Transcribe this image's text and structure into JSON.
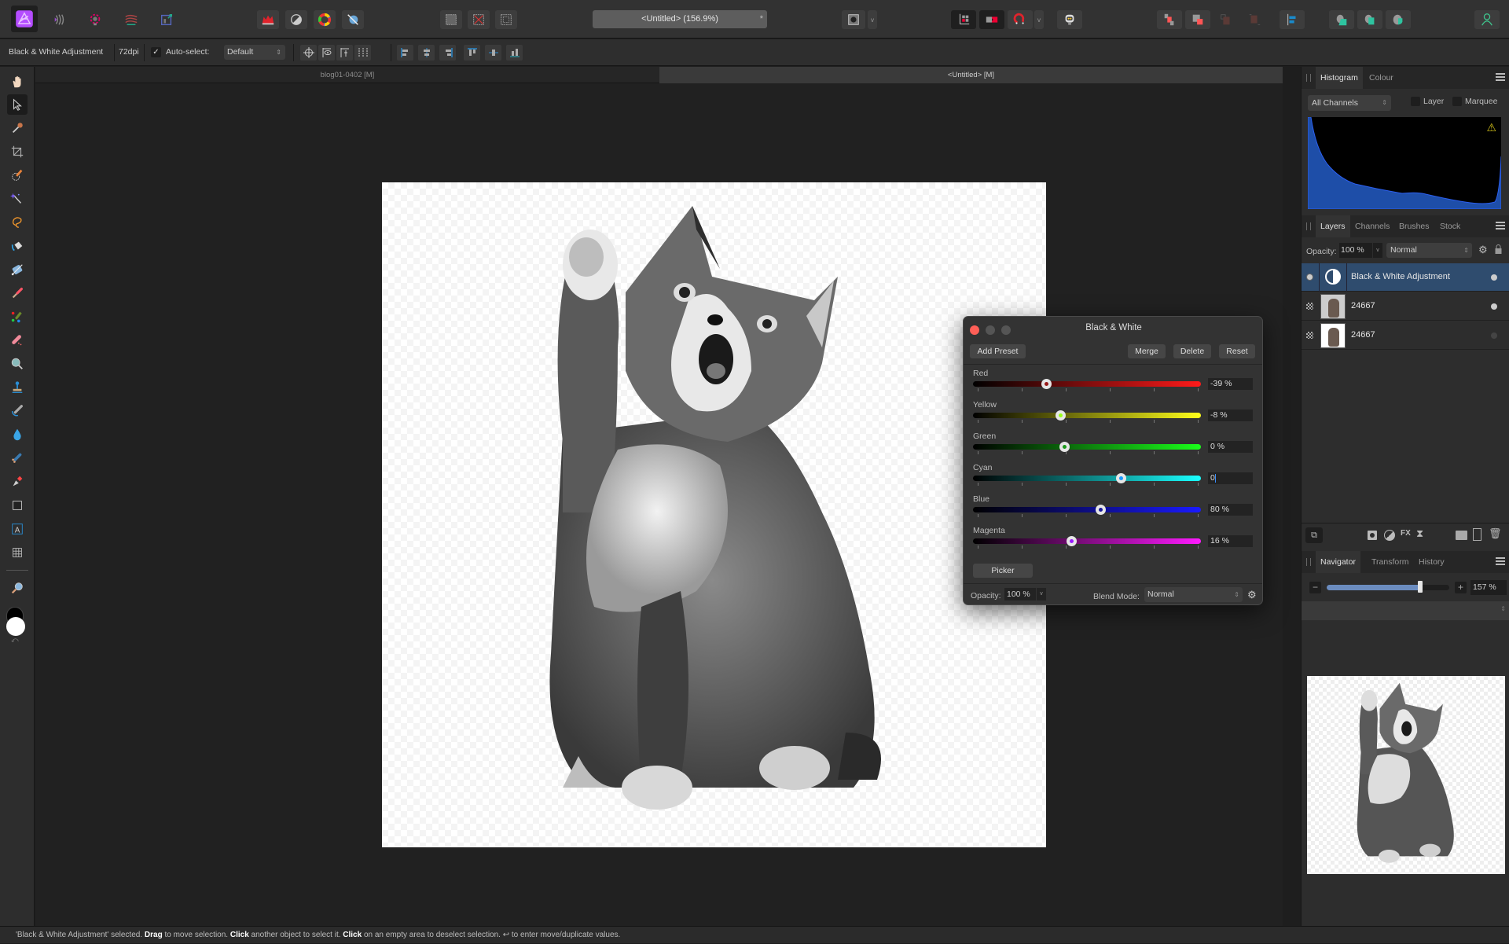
{
  "app": {
    "name": "Affinity Photo",
    "accent": "#a64cff"
  },
  "toolbar": {
    "personas": [
      "photo-persona",
      "liquify-persona",
      "develop-persona",
      "tone-mapping-persona",
      "export-persona"
    ],
    "document_title": "<Untitled> (156.9%)",
    "modified_marker": "*",
    "snapping_dropdown": "v"
  },
  "context_bar": {
    "selection_label": "Black & White Adjustment",
    "dpi": "72dpi",
    "auto_select_label": "Auto-select:",
    "auto_select_checked": true,
    "auto_select_value": "Default"
  },
  "doc_tabs": [
    {
      "label": "blog01-0402 [M]",
      "active": false
    },
    {
      "label": "<Untitled> [M]",
      "active": true
    }
  ],
  "histogram": {
    "tabs": [
      "Histogram",
      "Colour"
    ],
    "channel": "All Channels",
    "layer_label": "Layer",
    "marquee_label": "Marquee",
    "warning": true,
    "color": "#1e4ea8"
  },
  "layers_panel": {
    "tabs": [
      "Layers",
      "Channels",
      "Brushes",
      "Stock"
    ],
    "opacity_label": "Opacity:",
    "opacity_value": "100 %",
    "blend_mode": "Normal",
    "layers": [
      {
        "name": "Black & White Adjustment",
        "type": "adjustment",
        "selected": true,
        "visible": true
      },
      {
        "name": "24667",
        "type": "pixel",
        "selected": false,
        "visible": true
      },
      {
        "name": "24667",
        "type": "pixel",
        "selected": false,
        "visible": false
      }
    ]
  },
  "navigator": {
    "tabs": [
      "Navigator",
      "Transform",
      "History"
    ],
    "zoom_value": "157 %",
    "zoom_fraction": 0.76
  },
  "bw_dialog": {
    "title": "Black & White",
    "add_preset": "Add Preset",
    "merge": "Merge",
    "delete": "Delete",
    "reset": "Reset",
    "range": [
      -200,
      300
    ],
    "sliders": [
      {
        "label": "Red",
        "value_text": "-39 %",
        "value": -39,
        "color": "#ff1a1a"
      },
      {
        "label": "Yellow",
        "value_text": "-8 %",
        "value": -8,
        "color": "#ffff1a"
      },
      {
        "label": "Green",
        "value_text": "0 %",
        "value": 0,
        "color": "#1aff1a"
      },
      {
        "label": "Cyan",
        "value_text": "0",
        "value": 124,
        "color": "#1affff",
        "editing": true
      },
      {
        "label": "Blue",
        "value_text": "80 %",
        "value": 80,
        "color": "#1a1aff"
      },
      {
        "label": "Magenta",
        "value_text": "16 %",
        "value": 16,
        "color": "#ff1aff"
      }
    ],
    "picker": "Picker",
    "opacity_label": "Opacity:",
    "opacity_value": "100 %",
    "blend_mode_label": "Blend Mode:",
    "blend_mode_value": "Normal"
  },
  "status_bar": {
    "parts": [
      {
        "t": "'Black & White Adjustment' selected. ",
        "b": false
      },
      {
        "t": "Drag",
        "b": true
      },
      {
        "t": " to move selection. ",
        "b": false
      },
      {
        "t": "Click",
        "b": true
      },
      {
        "t": " another object to select it. ",
        "b": false
      },
      {
        "t": "Click",
        "b": true
      },
      {
        "t": " on an empty area to deselect selection. ↩ to enter move/duplicate values.",
        "b": false
      }
    ]
  }
}
